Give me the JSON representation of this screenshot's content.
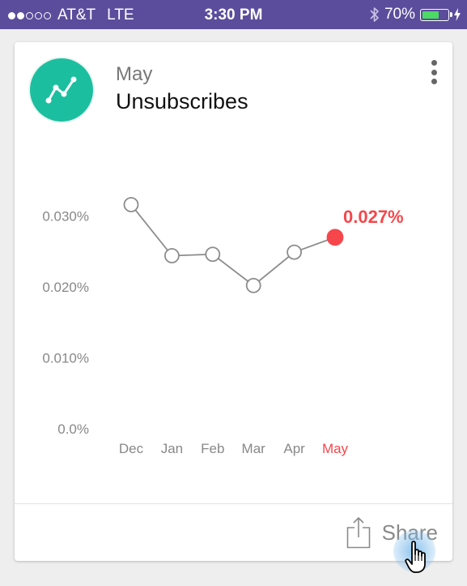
{
  "status_bar": {
    "carrier": "AT&T",
    "network": "LTE",
    "time": "3:30 PM",
    "battery": "70%",
    "battery_level": 0.7,
    "signal_bars_filled": 2,
    "signal_bars_total": 5,
    "icons": [
      "bluetooth-icon",
      "battery-icon",
      "charging-icon"
    ]
  },
  "card": {
    "subtitle": "May",
    "title": "Unsubscribes",
    "icon": "line-chart-icon",
    "accent_color": "#1bbf9f",
    "share_label": "Share",
    "share_icon": "share-icon"
  },
  "chart_data": {
    "type": "line",
    "categories": [
      "Dec",
      "Jan",
      "Feb",
      "Mar",
      "Apr",
      "May"
    ],
    "values": [
      0.0316,
      0.0244,
      0.0246,
      0.0202,
      0.0249,
      0.027
    ],
    "ylim": [
      0,
      0.03
    ],
    "y_ticks": [
      "0.0%",
      "0.010%",
      "0.020%",
      "0.030%"
    ],
    "highlight_index": 5,
    "highlight_label": "0.027%",
    "highlight_color": "#f5474b",
    "line_color": "#8c8c8c",
    "grid": false
  }
}
